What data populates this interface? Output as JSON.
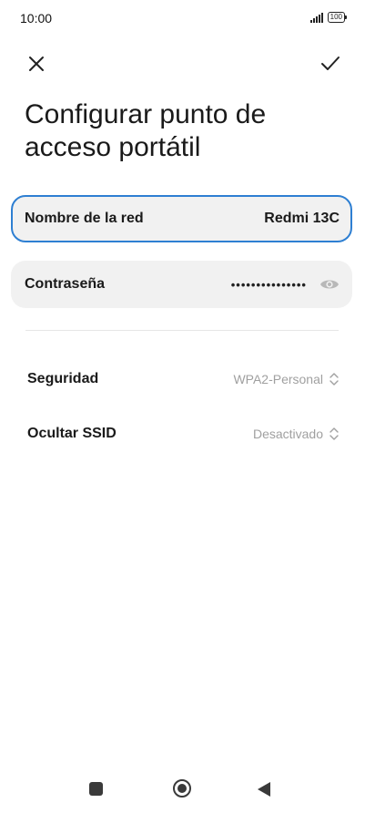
{
  "status_bar": {
    "time": "10:00",
    "battery": "100"
  },
  "action_bar": {
    "close_icon": "close-icon",
    "confirm_icon": "check-icon"
  },
  "title": "Configurar punto de acceso portátil",
  "network_name": {
    "label": "Nombre de la red",
    "value": "Redmi 13C"
  },
  "password": {
    "label": "Contraseña",
    "value": "•••••••••••••••",
    "visibility_icon": "eye-icon"
  },
  "settings": [
    {
      "label": "Seguridad",
      "value": "WPA2-Personal"
    },
    {
      "label": "Ocultar SSID",
      "value": "Desactivado"
    }
  ],
  "nav_bar": {
    "recents_icon": "square-icon",
    "home_icon": "circle-icon",
    "back_icon": "triangle-back-icon"
  },
  "colors": {
    "accent": "#2e7fd2",
    "card_bg": "#f1f1f1",
    "muted_text": "#a0a0a0"
  }
}
